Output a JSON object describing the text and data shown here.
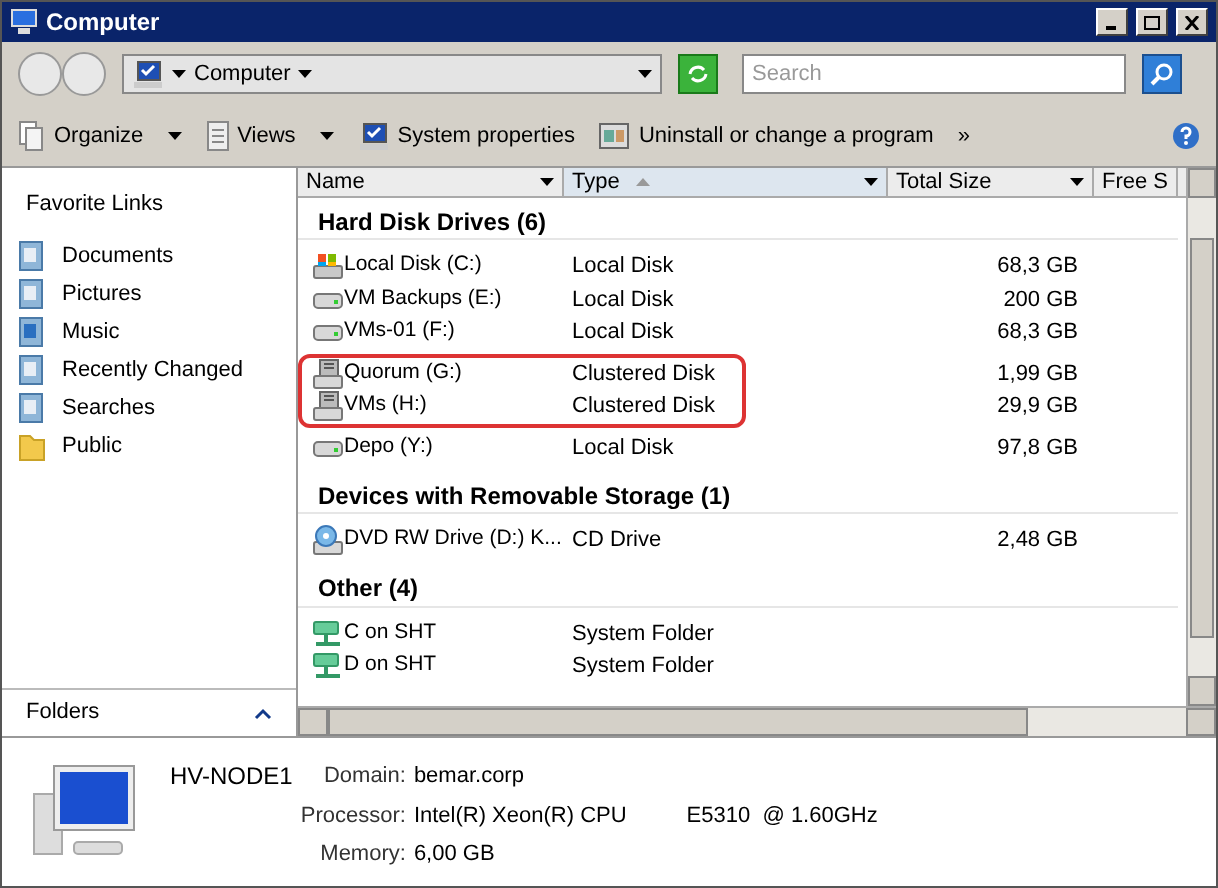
{
  "window": {
    "title": "Computer"
  },
  "address": {
    "crumb": "Computer",
    "search_placeholder": "Search"
  },
  "toolbar": [
    {
      "label": "Organize",
      "dropdown": true
    },
    {
      "label": "Views",
      "dropdown": true
    },
    {
      "label": "System properties",
      "dropdown": false
    },
    {
      "label": "Uninstall or change a program",
      "dropdown": false
    },
    {
      "label": "»",
      "dropdown": false
    }
  ],
  "favorites": {
    "title": "Favorite Links",
    "items": [
      {
        "label": "Documents"
      },
      {
        "label": "Pictures"
      },
      {
        "label": "Music"
      },
      {
        "label": "Recently Changed"
      },
      {
        "label": "Searches"
      },
      {
        "label": "Public"
      }
    ],
    "folders": "Folders"
  },
  "columns": [
    {
      "label": "Name",
      "sorted": false
    },
    {
      "label": "Type",
      "sorted": true
    },
    {
      "label": "Total Size",
      "sorted": false
    },
    {
      "label": "Free S",
      "sorted": false
    }
  ],
  "groups": [
    {
      "title": "Hard Disk Drives (6)",
      "rows": [
        {
          "name": "Local Disk (C:)",
          "type": "Local Disk",
          "size": "68,3 GB",
          "kind": "system",
          "highlighted": false
        },
        {
          "name": "VM Backups (E:)",
          "type": "Local Disk",
          "size": "200 GB",
          "kind": "drive",
          "highlighted": false
        },
        {
          "name": "VMs-01 (F:)",
          "type": "Local Disk",
          "size": "68,3 GB",
          "kind": "drive",
          "highlighted": false
        },
        {
          "name": "Quorum (G:)",
          "type": "Clustered Disk",
          "size": "1,99 GB",
          "kind": "cluster",
          "highlighted": true
        },
        {
          "name": "VMs (H:)",
          "type": "Clustered Disk",
          "size": "29,9 GB",
          "kind": "cluster",
          "highlighted": true
        },
        {
          "name": "Depo (Y:)",
          "type": "Local Disk",
          "size": "97,8 GB",
          "kind": "drive",
          "highlighted": false
        }
      ]
    },
    {
      "title": "Devices with Removable Storage (1)",
      "rows": [
        {
          "name": "DVD RW Drive (D:) K...",
          "type": "CD Drive",
          "size": "2,48 GB",
          "kind": "dvd",
          "highlighted": false
        }
      ]
    },
    {
      "title": "Other (4)",
      "rows": [
        {
          "name": "C on SHT",
          "type": "System Folder",
          "kind": "network",
          "highlighted": false
        },
        {
          "name": "D on SHT",
          "type": "System Folder",
          "kind": "network",
          "highlighted": false
        }
      ]
    }
  ],
  "details": {
    "name": "HV-NODE1",
    "fields": [
      {
        "label": "Domain:",
        "values": [
          "bemar.corp"
        ]
      },
      {
        "label": "Processor:",
        "values": [
          "Intel(R) Xeon(R) CPU",
          "E5310  @ 1.60GHz"
        ]
      },
      {
        "label": "Memory:",
        "values": [
          "6,00 GB"
        ]
      }
    ]
  }
}
